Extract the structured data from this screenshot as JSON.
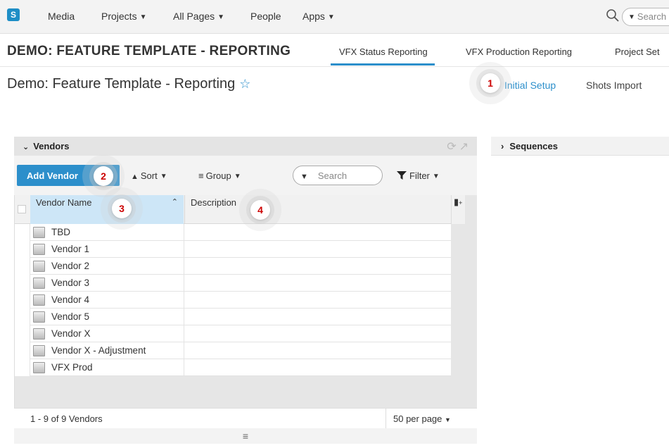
{
  "topnav": {
    "logo": "S",
    "items": [
      {
        "label": "Media",
        "dropdown": false
      },
      {
        "label": "Projects",
        "dropdown": true
      },
      {
        "label": "All Pages",
        "dropdown": true
      },
      {
        "label": "People",
        "dropdown": false
      },
      {
        "label": "Apps",
        "dropdown": true
      }
    ],
    "search_placeholder": "Search"
  },
  "project": {
    "title": "DEMO: FEATURE TEMPLATE - REPORTING",
    "tabs": [
      {
        "label": "VFX Status Reporting",
        "active": true
      },
      {
        "label": "VFX Production Reporting",
        "active": false
      },
      {
        "label": "Project Set",
        "active": false
      }
    ]
  },
  "page": {
    "title": "Demo: Feature Template - Reporting",
    "star": "☆",
    "sublinks": [
      {
        "label": "Initial Setup",
        "active": true
      },
      {
        "label": "Shots Import",
        "active": false
      }
    ]
  },
  "callouts": [
    "1",
    "2",
    "3",
    "4"
  ],
  "vendors_panel": {
    "title": "Vendors",
    "add_button": "Add Vendor",
    "sort": "Sort",
    "group": "Group",
    "search_placeholder": "Search",
    "filter": "Filter",
    "columns": [
      "Vendor Name",
      "Description"
    ],
    "rows": [
      "TBD",
      "Vendor 1",
      "Vendor 2",
      "Vendor 3",
      "Vendor 4",
      "Vendor 5",
      "Vendor X",
      "Vendor X - Adjustment",
      "VFX Prod"
    ],
    "footer_count": "1 - 9 of 9 Vendors",
    "per_page": "50 per page"
  },
  "sequences_panel": {
    "title": "Sequences"
  },
  "colors": {
    "accent": "#2c8fcb",
    "callout_text": "#cc0000",
    "selected_header": "#cde6f7"
  }
}
